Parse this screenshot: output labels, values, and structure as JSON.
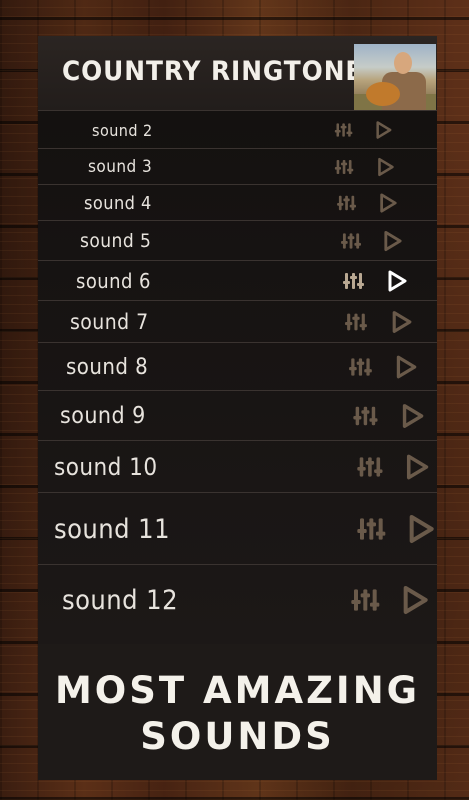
{
  "header": {
    "title": "COUNTRY RINGTONES",
    "avatar_icon": "guitarist-photo"
  },
  "sounds": [
    {
      "label": "sound 2",
      "active": false
    },
    {
      "label": "sound 3",
      "active": false
    },
    {
      "label": "sound 4",
      "active": false
    },
    {
      "label": "sound 5",
      "active": false
    },
    {
      "label": "sound 6",
      "active": true
    },
    {
      "label": "sound 7",
      "active": false
    },
    {
      "label": "sound 8",
      "active": false
    },
    {
      "label": "sound 9",
      "active": false
    },
    {
      "label": "sound 10",
      "active": false
    },
    {
      "label": "sound 11",
      "active": false
    },
    {
      "label": "sound 12",
      "active": false
    }
  ],
  "row_icons": {
    "settings": "equalizer-icon",
    "play": "play-icon"
  },
  "footer": {
    "line1": "MOST AMAZING",
    "line2": "SOUNDS"
  },
  "colors": {
    "panel": "#1f1a18",
    "icon_muted": "#6a5a4a",
    "icon_active": "#ffffff",
    "text": "#e7e3dd"
  }
}
